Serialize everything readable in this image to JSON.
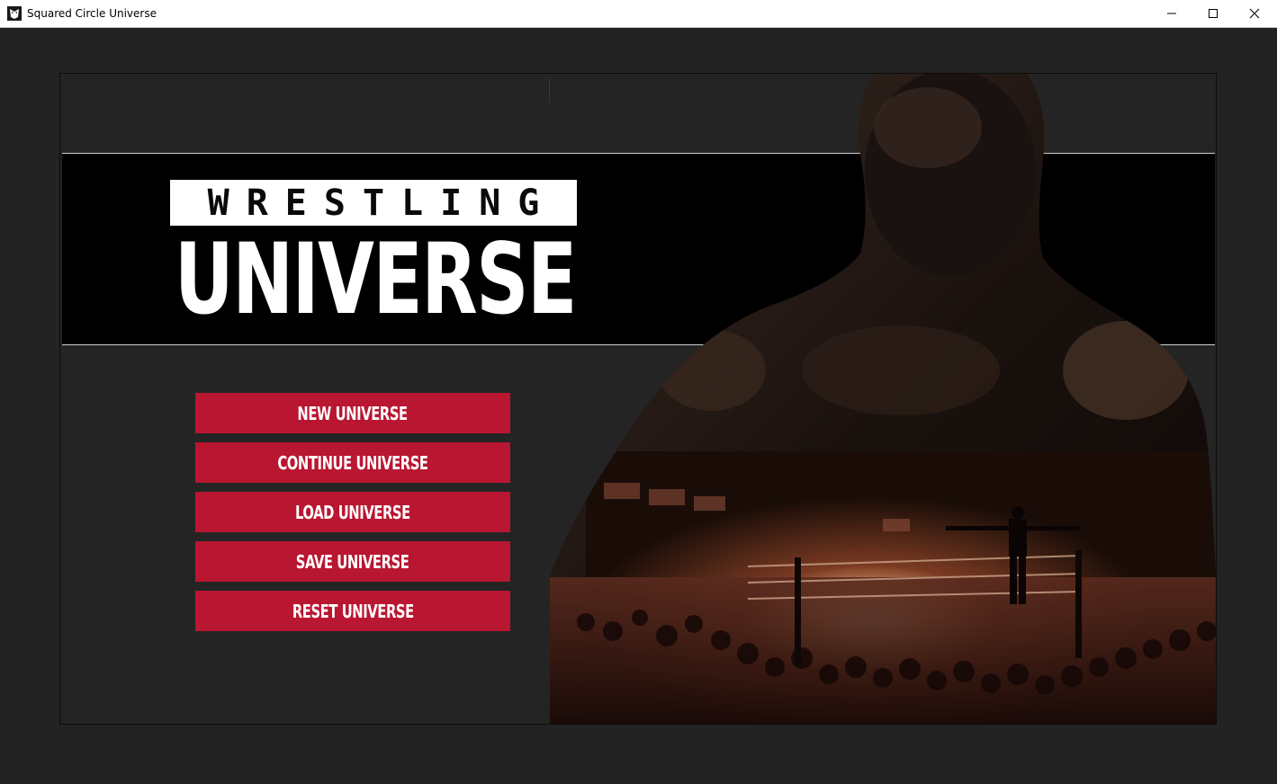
{
  "window": {
    "title": "Squared Circle Universe",
    "icon": "wrestler-mask-icon",
    "controls": [
      "minimize-icon",
      "maximize-icon",
      "close-icon"
    ]
  },
  "logo": {
    "line1": "WRESTLING",
    "line2": "UNIVERSE"
  },
  "menu": {
    "items": [
      {
        "label": "NEW UNIVERSE"
      },
      {
        "label": "CONTINUE UNIVERSE"
      },
      {
        "label": "LOAD UNIVERSE"
      },
      {
        "label": "SAVE UNIVERSE"
      },
      {
        "label": "RESET UNIVERSE"
      }
    ]
  },
  "colors": {
    "background": "#232323",
    "banner": "#000000",
    "button": "#b91631",
    "button_text": "#ffffff"
  }
}
